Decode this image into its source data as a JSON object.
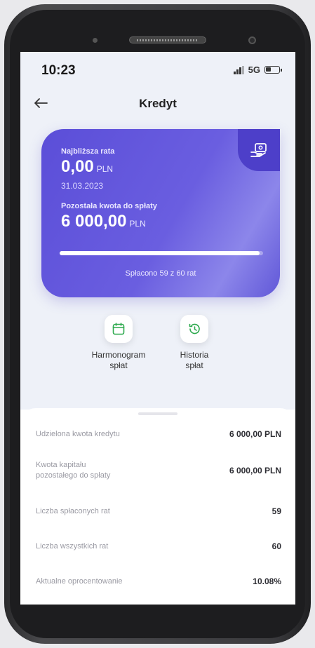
{
  "status_bar": {
    "time": "10:23",
    "network": "5G"
  },
  "header": {
    "title": "Kredyt"
  },
  "card": {
    "next_installment_label": "Najbliższa rata",
    "next_installment_amount": "0,00",
    "next_installment_currency": "PLN",
    "next_installment_date": "31.03.2023",
    "remaining_label": "Pozostała kwota do spłaty",
    "remaining_amount": "6 000,00",
    "remaining_currency": "PLN",
    "progress_fraction": 0.983,
    "progress_caption": "Spłacono 59 z 60 rat"
  },
  "actions": [
    {
      "label": "Harmonogram\nspłat",
      "icon": "calendar-icon"
    },
    {
      "label": "Historia\nspłat",
      "icon": "history-icon"
    }
  ],
  "details": [
    {
      "label": "Udzielona kwota kredytu",
      "value": "6 000,00 PLN"
    },
    {
      "label": "Kwota kapitału\npozostałego do spłaty",
      "value": "6 000,00 PLN"
    },
    {
      "label": "Liczba spłaconych rat",
      "value": "59"
    },
    {
      "label": "Liczba wszystkich rat",
      "value": "60"
    },
    {
      "label": "Aktualne oprocentowanie",
      "value": "10.08%"
    }
  ],
  "colors": {
    "accent": "#5b4ed8",
    "accent_dark": "#4d3fc9",
    "action_icon": "#2faa4f"
  }
}
